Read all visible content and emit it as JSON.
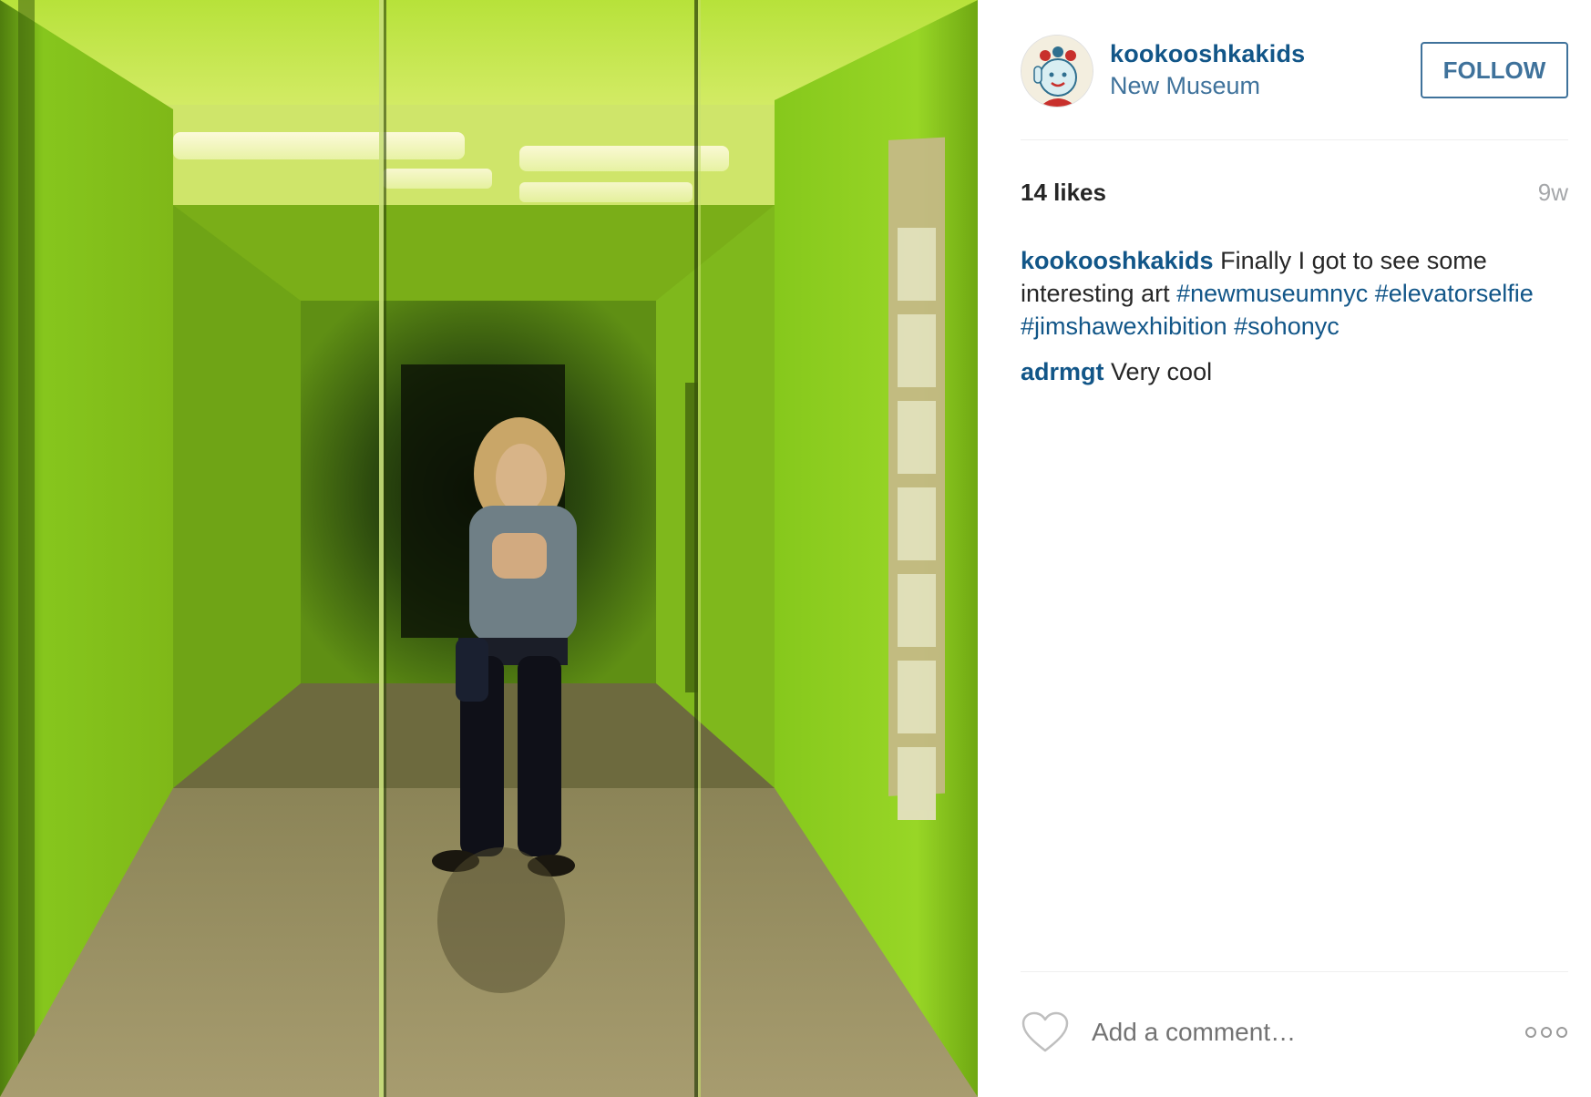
{
  "post": {
    "username": "kookooshkakids",
    "location": "New Museum",
    "follow_label": "FOLLOW",
    "likes": "14 likes",
    "time_ago": "9w"
  },
  "caption": {
    "user": "kookooshkakids",
    "text": "Finally I got to see some interesting art",
    "hashtags": [
      "#newmuseumnyc",
      "#elevatorselfie",
      "#jimshawexhibition",
      "#sohonyc"
    ]
  },
  "comments": [
    {
      "user": "adrmgt",
      "text": "Very cool"
    }
  ],
  "footer": {
    "comment_placeholder": "Add a comment…"
  },
  "colors": {
    "username_blue": "#125688",
    "link_blue": "#3f729b",
    "muted_gray": "#a5a7aa",
    "divider": "#efefef",
    "elevator_green": "#8fd11e"
  },
  "icons": {
    "like": "heart-outline-icon",
    "more": "more-options-icon"
  }
}
